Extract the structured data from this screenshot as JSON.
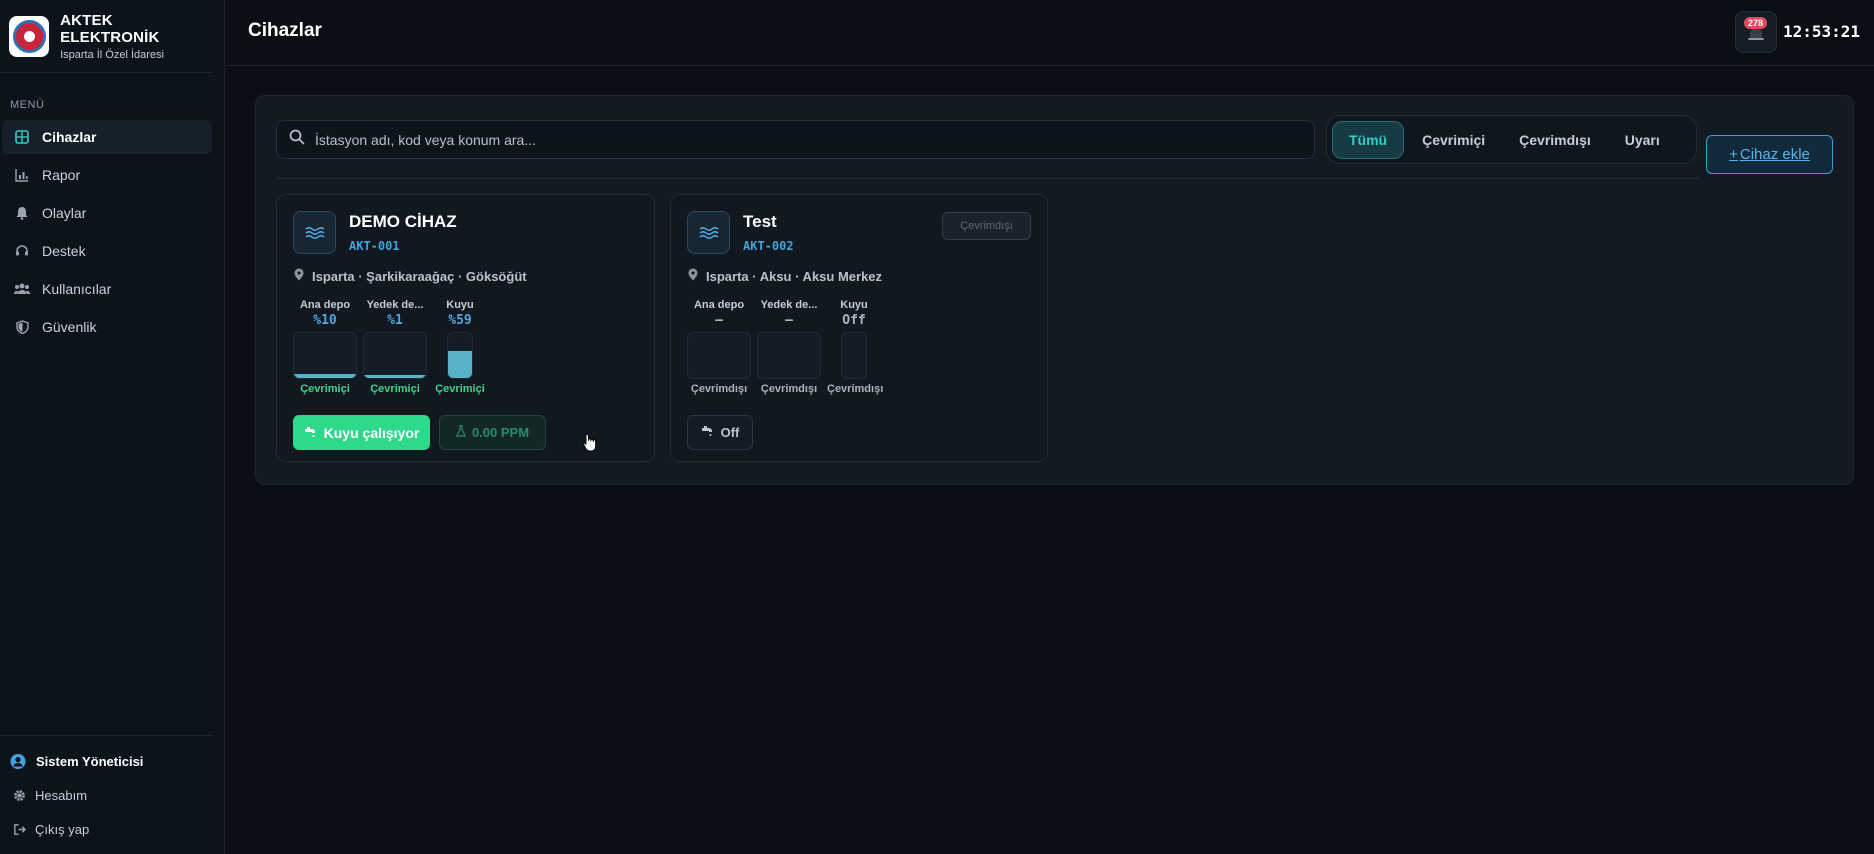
{
  "brand": {
    "title": "AKTEK ELEKTRONİK",
    "subtitle": "Isparta İl Özel İdaresi"
  },
  "sidebar": {
    "menu_label": "MENÜ",
    "items": [
      {
        "label": "Cihazlar",
        "icon": "grid-icon",
        "active": true
      },
      {
        "label": "Rapor",
        "icon": "chart-icon"
      },
      {
        "label": "Olaylar",
        "icon": "bell-icon"
      },
      {
        "label": "Destek",
        "icon": "headset-icon"
      },
      {
        "label": "Kullanıcılar",
        "icon": "users-icon"
      },
      {
        "label": "Güvenlik",
        "icon": "shield-icon"
      }
    ],
    "user_name": "Sistem Yöneticisi",
    "account_label": "Hesabım",
    "logout_label": "Çıkış yap"
  },
  "header": {
    "title": "Cihazlar",
    "notification_count": "278",
    "clock": "12:53:21"
  },
  "search": {
    "placeholder": "İstasyon adı, kod veya konum ara..."
  },
  "filters": [
    "Tümü",
    "Çevrimiçi",
    "Çevrimdışı",
    "Uyarı"
  ],
  "active_filter": "Tümü",
  "add_device_label": "Cihaz ekle",
  "devices": [
    {
      "name": "DEMO CİHAZ",
      "code": "AKT-001",
      "location": "Isparta · Şarkikaraağaç · Göksöğüt",
      "tanks": [
        {
          "label": "Ana depo",
          "value": "%10",
          "level": 0.1,
          "status": "Çevrimiçi"
        },
        {
          "label": "Yedek de...",
          "value": "%1",
          "level": 0.01,
          "status": "Çevrimiçi"
        },
        {
          "label": "Kuyu",
          "value": "%59",
          "level": 0.59,
          "status": "Çevrimiçi"
        }
      ],
      "pump_label": "Kuyu çalışıyor",
      "ppm_label": "0.00 PPM"
    },
    {
      "name": "Test",
      "code": "AKT-002",
      "status_badge": "Çevrimdışı",
      "location": "Isparta · Aksu · Aksu Merkez",
      "tanks": [
        {
          "label": "Ana depo",
          "value": "—",
          "level": 0,
          "status": "Çevrimdışı"
        },
        {
          "label": "Yedek de...",
          "value": "—",
          "level": 0,
          "status": "Çevrimdışı"
        },
        {
          "label": "Kuyu",
          "value": "Off",
          "level": 0,
          "status": "Çevrimdışı"
        }
      ],
      "pump_label": "Off"
    }
  ],
  "colors": {
    "accent": "#35d0c6",
    "online": "#3fd490",
    "primary_blue": "#3fa4df",
    "pump_green": "#2fd98c"
  }
}
